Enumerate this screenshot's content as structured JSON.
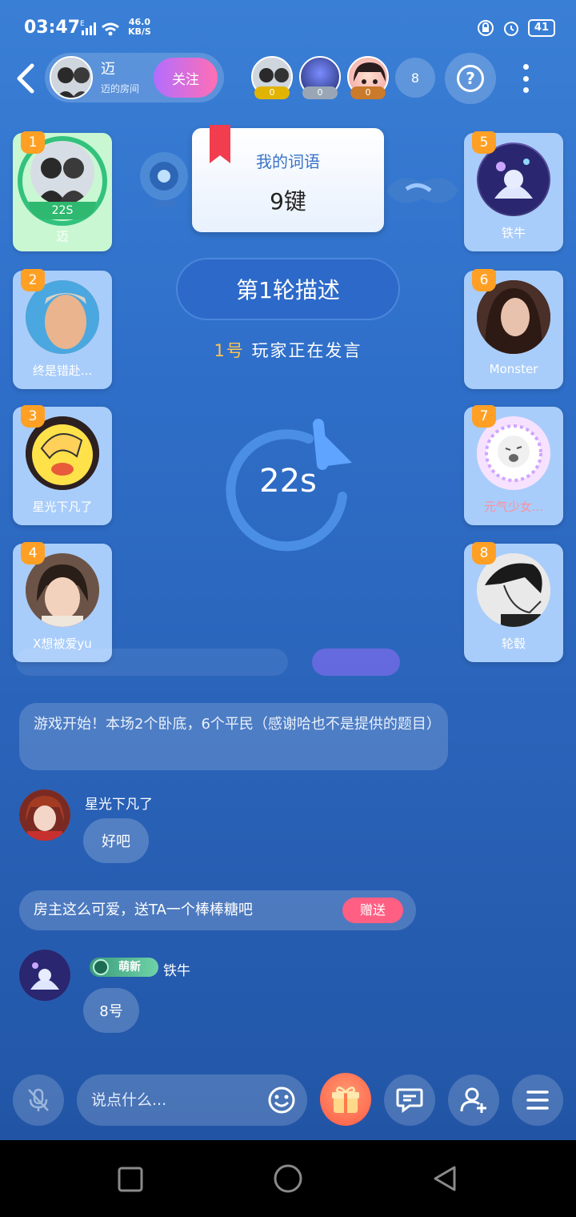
{
  "status": {
    "time": "03:47",
    "net": "E",
    "speed_value": "46.0",
    "speed_unit": "KB/S",
    "battery": "41"
  },
  "owner": {
    "name": "迈",
    "subtitle": "迈的房间",
    "follow_label": "关注"
  },
  "viewers": {
    "badges": [
      "0",
      "0",
      "0"
    ],
    "count": "8"
  },
  "seats": [
    {
      "num": "1",
      "name": "迈",
      "timer": "22S"
    },
    {
      "num": "2",
      "name": "终是错赴..."
    },
    {
      "num": "3",
      "name": "星光下凡了"
    },
    {
      "num": "4",
      "name": "X想被爱yu"
    },
    {
      "num": "5",
      "name": "铁牛"
    },
    {
      "num": "6",
      "name": "Monster"
    },
    {
      "num": "7",
      "name": "元气少女..."
    },
    {
      "num": "8",
      "name": "轮毂"
    }
  ],
  "word_card": {
    "title": "我的词语",
    "value": "9键"
  },
  "round": {
    "label": "第1轮描述"
  },
  "speaking": {
    "num": "1号",
    "text": "玩家正在发言"
  },
  "timer": {
    "label": "22s"
  },
  "chat": {
    "system": "游戏开始！本场2个卧底，6个平民（感谢哈也不是提供的题目）",
    "messages": [
      {
        "name": "星光下凡了",
        "text": "好吧"
      },
      {
        "name": "铁牛",
        "badge": "萌新",
        "text": "8号"
      }
    ],
    "gift_prompt": "房主这么可爱，送TA一个棒棒糖吧",
    "gift_button": "赠送"
  },
  "input": {
    "placeholder": "说点什么..."
  },
  "colors": {
    "seat_bg": "#a9cdfa",
    "active_seat_bg": "#c9f7d2",
    "seat_number": "#ffa025",
    "accent_pink": "#ff5f83",
    "speaking_num": "#ffc552"
  }
}
